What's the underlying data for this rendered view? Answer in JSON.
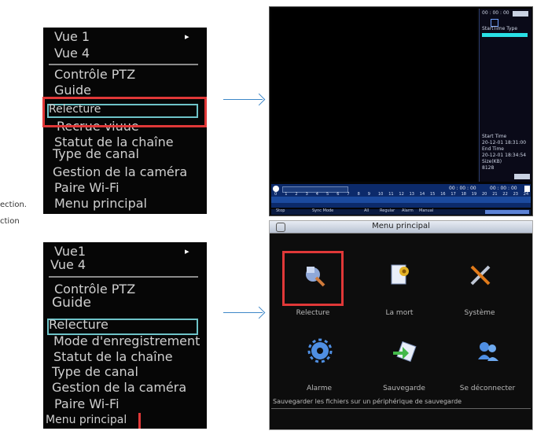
{
  "side_text": {
    "line1": "ection.",
    "line2": "ction"
  },
  "top_menu": {
    "items": [
      "Vue 1",
      "Vue 4",
      "Contrôle PTZ",
      "Guide",
      "Relecture",
      "Recrue viuue",
      "Statut de la chaîne",
      "Type de canal",
      "Gestion de la caméra",
      "Paire Wi-Fi",
      "Menu principal"
    ],
    "submenu_arrow": "▸"
  },
  "bottom_menu": {
    "items": [
      "Vue1",
      "Vue 4",
      "Contrôle PTZ",
      "Guide",
      "Relecture",
      "Mode d'enregistrement",
      "Statut de la chaîne",
      "Type de canal",
      "Gestion de la caméra",
      "Paire Wi-Fi",
      "Menu principal"
    ],
    "submenu_arrow": "▸"
  },
  "playback": {
    "clock": "00 : 00 : 00",
    "list_header": "StartTime Type",
    "start_label": "Start Time",
    "start_value": "20-12-01 18:31:00",
    "end_label": "End Time",
    "end_value": "20-12-01 18:34:54",
    "size_label": "Size(KB)",
    "size_value": "8128",
    "time_a": "00 : 00 : 00",
    "time_b": "00 : 00 : 00",
    "ticks": [
      "0",
      "1",
      "2",
      "3",
      "4",
      "5",
      "6",
      "7",
      "8",
      "9",
      "10",
      "11",
      "12",
      "13",
      "14",
      "15",
      "16",
      "17",
      "18",
      "19",
      "20",
      "21",
      "22",
      "23",
      "24"
    ],
    "bottom": [
      "Stop",
      "Sync Mode",
      "All",
      "Regular",
      "Alarm",
      "Manual"
    ]
  },
  "main_menu": {
    "title": "Menu principal",
    "items": [
      {
        "label": "Relecture",
        "icon": "playback-icon"
      },
      {
        "label": "La mort",
        "icon": "record-icon"
      },
      {
        "label": "Système",
        "icon": "tools-icon"
      },
      {
        "label": "Alarme",
        "icon": "gear-icon"
      },
      {
        "label": "Sauvegarde",
        "icon": "backup-icon"
      },
      {
        "label": "Se déconnecter",
        "icon": "logout-icon"
      }
    ],
    "status": "Sauvegarder les fichiers sur un périphérique de sauvegarde"
  },
  "colors": {
    "highlight": "#6ec3c8",
    "red": "#e03838",
    "arrow": "#3d87c8"
  }
}
